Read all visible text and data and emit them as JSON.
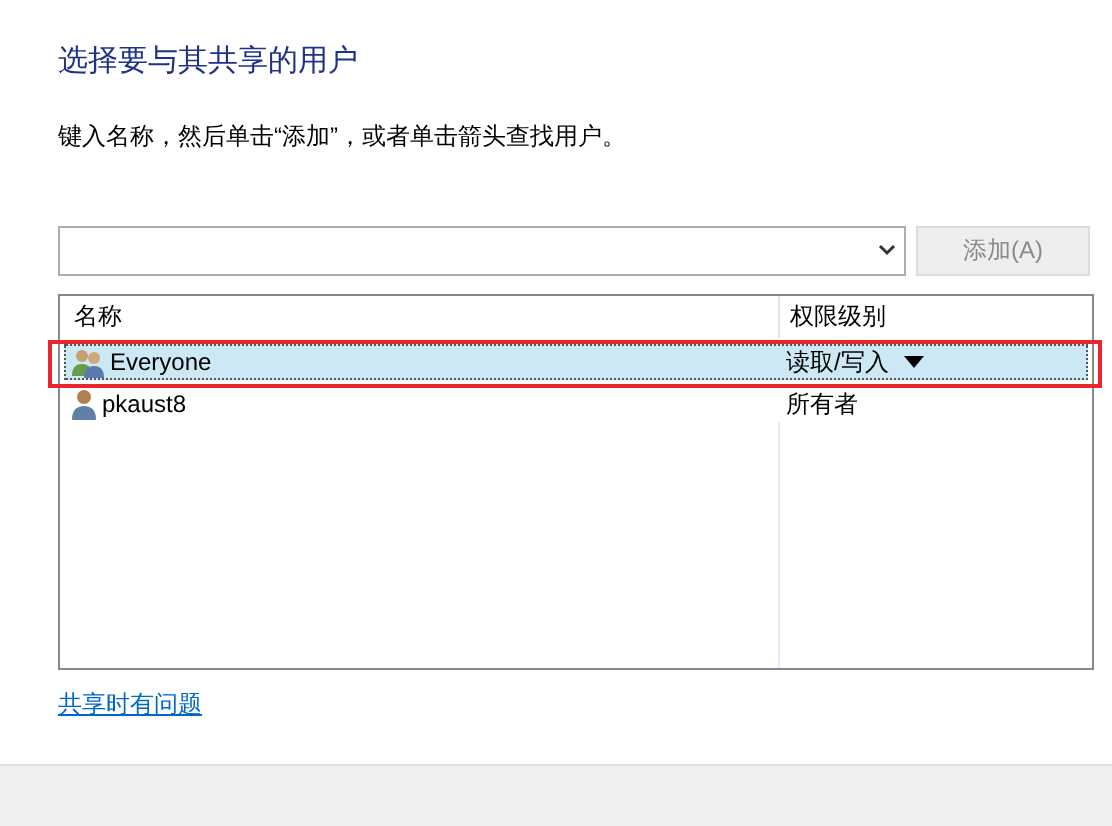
{
  "title": "选择要与其共享的用户",
  "instruction": "键入名称，然后单击“添加”，或者单击箭头查找用户。",
  "add_button": {
    "label": "添加(A)",
    "disabled": true
  },
  "table": {
    "columns": [
      "名称",
      "权限级别"
    ],
    "rows": [
      {
        "name": "Everyone",
        "kind": "group",
        "permission": "读取/写入",
        "has_menu": true,
        "selected": true,
        "highlighted": true
      },
      {
        "name": "pkaust8",
        "kind": "user",
        "permission": "所有者",
        "has_menu": false,
        "selected": false,
        "highlighted": false
      }
    ]
  },
  "help_link": "共享时有问题"
}
